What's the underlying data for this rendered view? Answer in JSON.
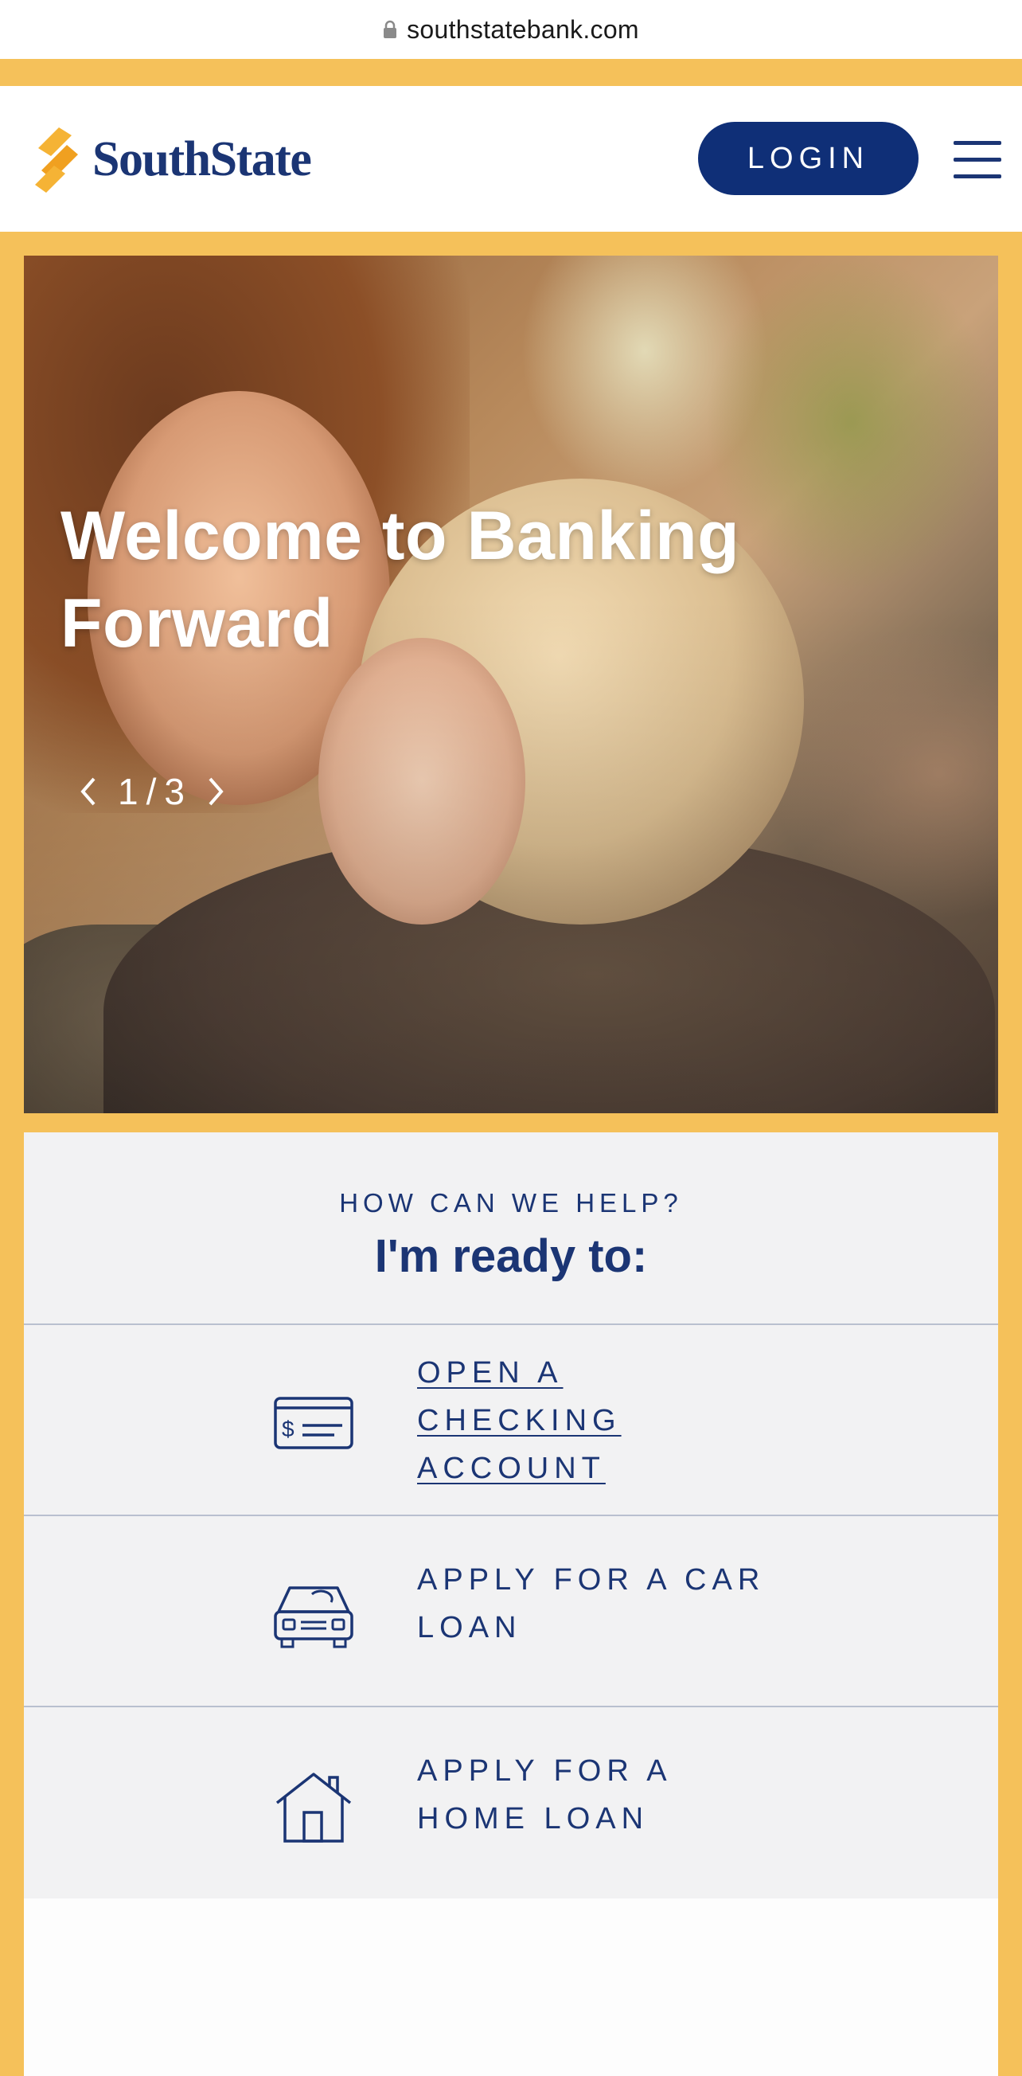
{
  "browser": {
    "url": "southstatebank.com"
  },
  "header": {
    "logo_text": "SouthState",
    "login_label": "LOGIN"
  },
  "hero": {
    "title": "Welcome to Banking Forward",
    "slide_current": "1",
    "slide_total": "3"
  },
  "help": {
    "eyebrow": "HOW CAN WE HELP?",
    "title": "I'm ready to:",
    "items": [
      {
        "label": "OPEN A CHECKING ACCOUNT",
        "icon": "check-icon"
      },
      {
        "label": "APPLY FOR A CAR LOAN",
        "icon": "car-icon"
      },
      {
        "label": "APPLY FOR A HOME LOAN",
        "icon": "house-icon"
      }
    ]
  },
  "colors": {
    "brand_navy": "#1b3574",
    "login_bg": "#0f2f77",
    "accent_yellow": "#f5c15a",
    "panel_bg": "#f2f2f3"
  }
}
